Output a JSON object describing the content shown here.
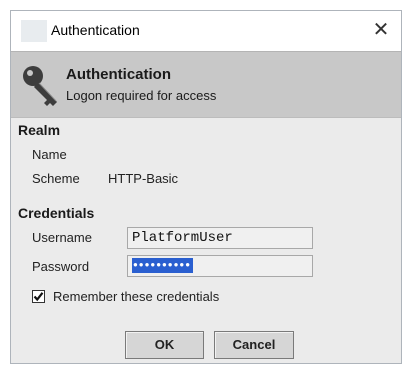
{
  "window": {
    "title": "Authentication",
    "close_glyph": "✕",
    "app_icon": "blank-app-icon"
  },
  "header": {
    "title": "Authentication",
    "subtitle": "Logon required for access",
    "icon": "key-icon"
  },
  "realm": {
    "heading": "Realm",
    "name_label": "Name",
    "name_value": "",
    "scheme_label": "Scheme",
    "scheme_value": "HTTP-Basic"
  },
  "credentials": {
    "heading": "Credentials",
    "username_label": "Username",
    "username_value": "PlatformUser",
    "password_label": "Password",
    "password_mask": "●●●●●●●●●●",
    "remember_label": "Remember these credentials",
    "remember_checked": true
  },
  "buttons": {
    "ok_label": "OK",
    "cancel_label": "Cancel"
  },
  "colors": {
    "header_band": "#c8c8c8",
    "dialog_bg": "#ebebeb",
    "selection": "#2a5fd0"
  }
}
